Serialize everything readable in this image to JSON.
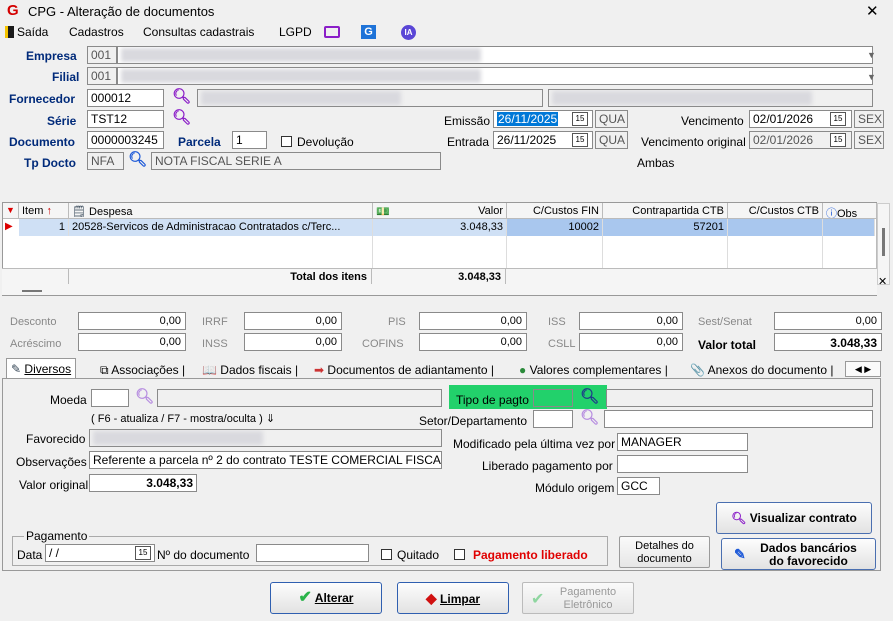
{
  "window": {
    "title": "CPG - Alteração de documentos",
    "close": "✕"
  },
  "menu": {
    "saida": "Saída",
    "cadastros": "Cadastros",
    "consultas": "Consultas cadastrais",
    "lgpd": "LGPD",
    "ia": "IA",
    "g": "G"
  },
  "header": {
    "empresa_label": "Empresa",
    "empresa_code": "001",
    "filial_label": "Filial",
    "filial_code": "001",
    "fornecedor_label": "Fornecedor",
    "fornecedor_code": "000012",
    "serie_label": "Série",
    "serie_value": "TST12",
    "emissao_label": "Emissão",
    "emissao_date": "26/11/2025",
    "emissao_day": "QUA",
    "vencimento_label": "Vencimento",
    "vencimento_date": "02/01/2026",
    "vencimento_day": "SEX",
    "documento_label": "Documento",
    "documento_value": "0000003245",
    "parcela_label": "Parcela",
    "parcela_value": "1",
    "devolucao_label": "Devolução",
    "entrada_label": "Entrada",
    "entrada_date": "26/11/2025",
    "entrada_day": "QUA",
    "venc_original_label": "Vencimento original",
    "venc_original_date": "02/01/2026",
    "venc_original_day": "SEX",
    "tpdocto_label": "Tp Docto",
    "tpdocto_code": "NFA",
    "tpdocto_desc": "NOTA FISCAL SERIE A",
    "ambas": "Ambas"
  },
  "grid": {
    "headers": {
      "item": "Item",
      "despesa": "Despesa",
      "valor": "Valor",
      "cc_fin": "C/Custos FIN",
      "contrapartida": "Contrapartida CTB",
      "cc_ctb": "C/Custos CTB",
      "obs": "Obs"
    },
    "rows": [
      {
        "item": "1",
        "despesa": "20528-Servicos de Administracao Contratados c/Terc...",
        "valor": "3.048,33",
        "cc_fin": "10002",
        "contrapartida": "57201",
        "cc_ctb": "",
        "obs": ""
      }
    ],
    "total_label": "Total dos itens",
    "total_value": "3.048,33"
  },
  "summary": {
    "desconto_label": "Desconto",
    "desconto": "0,00",
    "irrf_label": "IRRF",
    "irrf": "0,00",
    "pis_label": "PIS",
    "pis": "0,00",
    "iss_label": "ISS",
    "iss": "0,00",
    "sest_label": "Sest/Senat",
    "sest": "0,00",
    "acrescimo_label": "Acréscimo",
    "acrescimo": "0,00",
    "inss_label": "INSS",
    "inss": "0,00",
    "cofins_label": "COFINS",
    "cofins": "0,00",
    "csll_label": "CSLL",
    "csll": "0,00",
    "valortotal_label": "Valor total",
    "valortotal": "3.048,33"
  },
  "tabs": [
    "Diversos",
    "Associações",
    "Dados fiscais",
    "Documentos de adiantamento",
    "Valores complementares",
    "Anexos do documento"
  ],
  "diversos": {
    "moeda_label": "Moeda",
    "moeda": "",
    "tipo_pagto_label": "Tipo de pagto",
    "tipo_pagto": "",
    "hint": "( F6 - atualiza / F7 - mostra/oculta )",
    "setor_label": "Setor/Departamento",
    "setor": "",
    "favorecido_label": "Favorecido",
    "observacoes_label": "Observações",
    "observacoes": "Referente a parcela nº 2 do contrato TESTE COMERCIAL FISCA",
    "modificado_label": "Modificado pela última vez por",
    "modificado": "MANAGER",
    "liberado_label": "Liberado pagamento por",
    "liberado": "",
    "valor_original_label": "Valor original",
    "valor_original": "3.048,33",
    "modulo_label": "Módulo origem",
    "modulo": "GCC",
    "visualizar_btn": "Visualizar contrato",
    "pagamento_legend": "Pagamento",
    "data_label": "Data",
    "data_value": " / /",
    "ndoc_label": "Nº do documento",
    "ndoc": "",
    "quitado_label": "Quitado",
    "pag_liberado_label": "Pagamento liberado",
    "detalhes_btn_1": "Detalhes do",
    "detalhes_btn_2": "documento",
    "dados_bancarios_1": "Dados bancários",
    "dados_bancarios_2": "do favorecido"
  },
  "footer": {
    "alterar": "Alterar",
    "limpar": "Limpar",
    "pag_eletronico_1": "Pagamento",
    "pag_eletronico_2": "Eletrônico"
  },
  "colors": {
    "selection": "#0078d7",
    "green": "#22d16b",
    "magnifier": "#8b1ec8",
    "label_blue": "#002a7a",
    "red": "#e00000"
  }
}
